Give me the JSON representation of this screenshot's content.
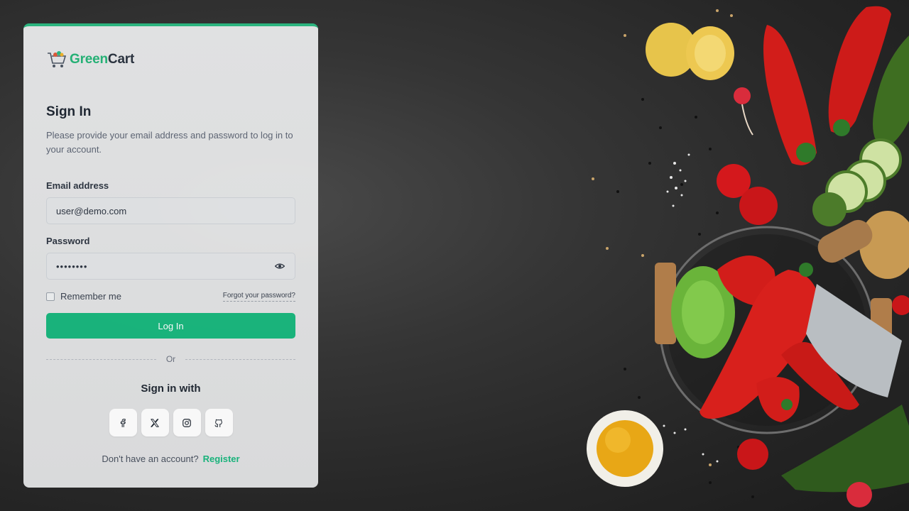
{
  "brand": {
    "name_part1": "Green",
    "name_part2": "Cart",
    "accent_color": "#19b77e"
  },
  "signin": {
    "title": "Sign In",
    "subtitle": "Please provide your email address and password to log in to your account."
  },
  "form": {
    "email_label": "Email address",
    "email_value": "user@demo.com",
    "password_label": "Password",
    "password_value": "password",
    "remember_label": "Remember me",
    "remember_checked": false,
    "forgot_label": "Forgot your password?",
    "login_label": "Log In"
  },
  "divider_text": "Or",
  "social": {
    "heading": "Sign in with",
    "providers": [
      "facebook-icon",
      "x-icon",
      "instagram-icon",
      "github-icon"
    ]
  },
  "register": {
    "prompt": "Don't have an account?",
    "link": "Register"
  }
}
